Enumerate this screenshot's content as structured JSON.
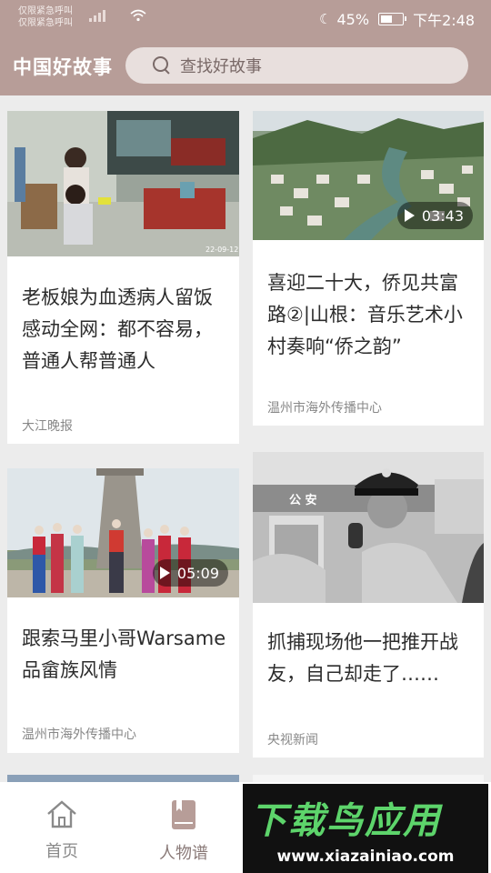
{
  "status_bar": {
    "carrier_line1": "仅限紧急呼叫",
    "carrier_line2": "仅限紧急呼叫",
    "battery": "45%",
    "time": "下午2:48"
  },
  "header": {
    "app_title": "中国好故事",
    "search_placeholder": "查找好故事"
  },
  "cards": [
    {
      "title": "老板娘为血透病人留饭感动全网：都不容易，普通人帮普通人",
      "source": "大江晚报",
      "image_stamp": "22-09-12"
    },
    {
      "title": "喜迎二十大，侨见共富路②|山根：音乐艺术小村奏响“侨之韵”",
      "source": "温州市海外传播中心",
      "duration": "03:43"
    },
    {
      "title": "跟索马里小哥Warsame品畲族风情",
      "source": "温州市海外传播中心",
      "duration": "05:09"
    },
    {
      "title": "抓捕现场他一把推开战友，自己却走了……",
      "source": "央视新闻",
      "image_sign": "公 安"
    }
  ],
  "bottom_nav": {
    "items": [
      {
        "label": "首页",
        "icon": "home-icon"
      },
      {
        "label": "人物谱",
        "icon": "book-icon"
      }
    ],
    "active": "人物谱"
  },
  "watermark": {
    "brand": "下载鸟应用",
    "url": "www.xiazainiao.com"
  },
  "colors": {
    "header_bg": "#b79d98",
    "page_bg": "#ececec",
    "brand_green": "#5dd46b"
  }
}
